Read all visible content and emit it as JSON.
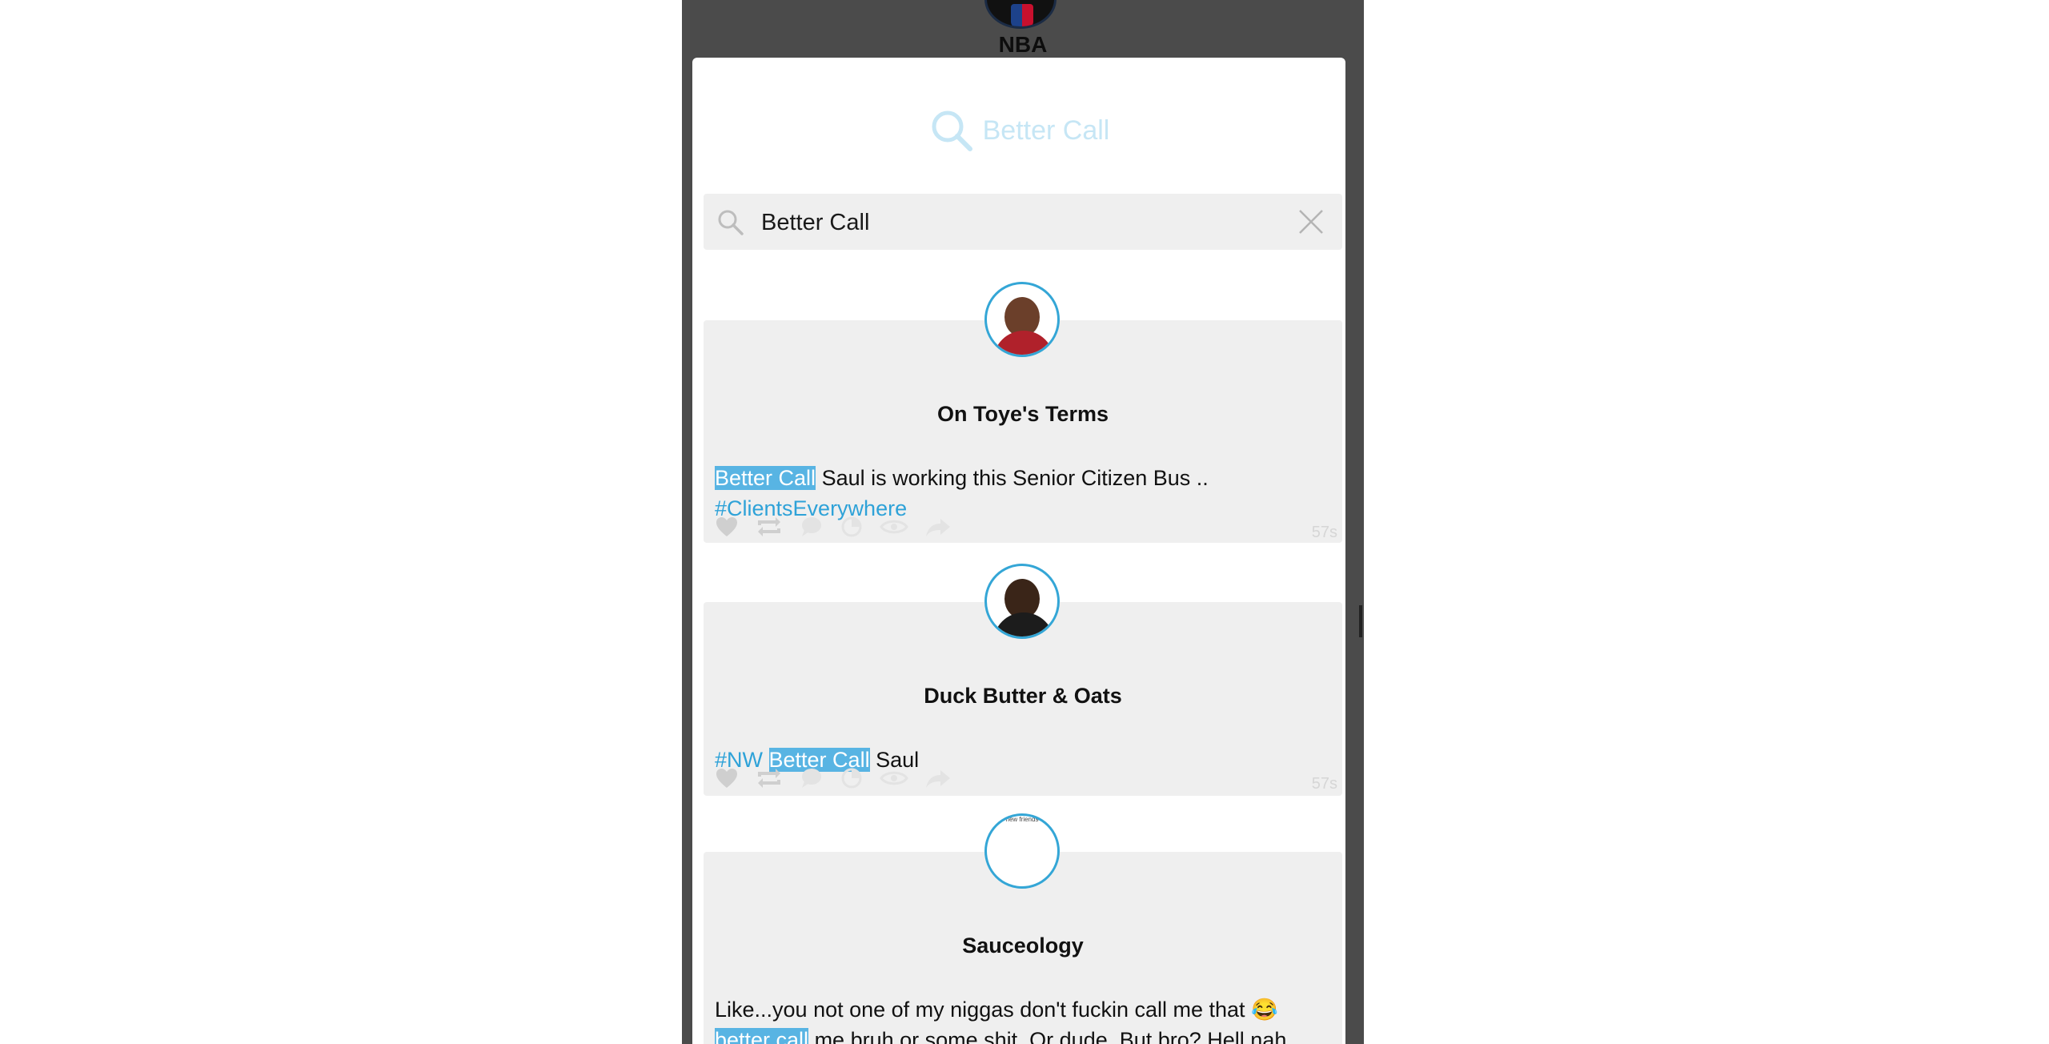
{
  "background": {
    "title": "NBA"
  },
  "modal": {
    "header_title": "Better Call",
    "search": {
      "value": "Better Call",
      "placeholder": ""
    }
  },
  "results": [
    {
      "name": "On Toye's Terms",
      "highlight": "Better Call",
      "text_after": " Saul is working this Senior Citizen Bus ..",
      "hashtag": "#ClientsEverywhere",
      "time": "57s"
    },
    {
      "name": "Duck Butter & Oats",
      "hashtag": "#NW",
      "highlight": "Better Call",
      "text_after": " Saul",
      "time": "57s"
    },
    {
      "name": "Sauceology",
      "avatar_caption": "new friends",
      "text_before": "Like...you not one of my niggas don't fuckin call me that 😂 ",
      "highlight": "better call",
      "text_after": " me bruh or some shit. Or dude. But bro? Hell nah."
    }
  ],
  "colors": {
    "accent": "#34a6d6",
    "highlight": "#58b4e3",
    "card": "#efefef",
    "frame": "#4b4b4b"
  },
  "icons": [
    "search-icon",
    "close-icon",
    "heart-icon",
    "retweet-icon",
    "comment-icon",
    "pie-icon",
    "eye-icon",
    "share-icon"
  ]
}
